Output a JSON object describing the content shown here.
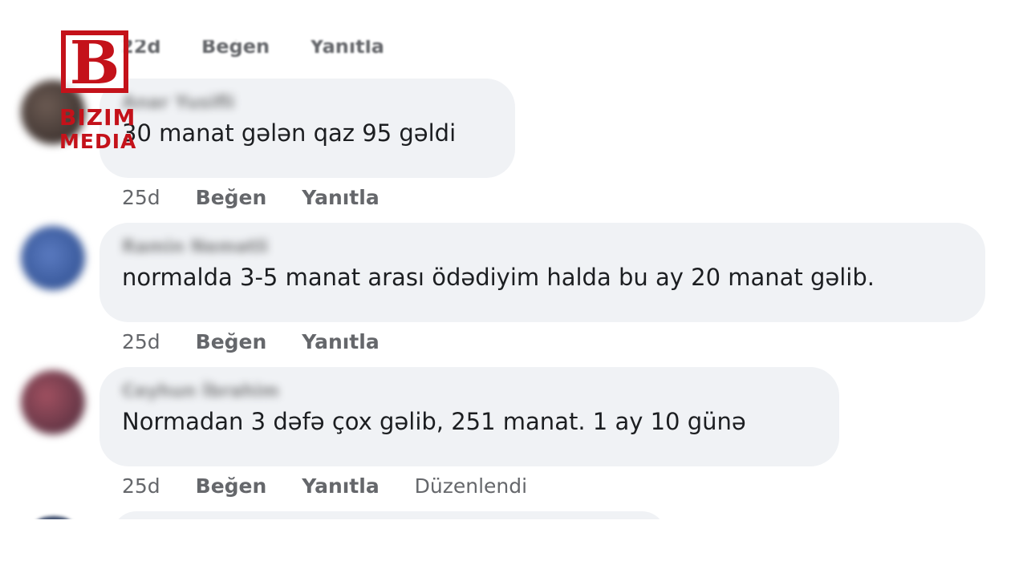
{
  "logo": {
    "letter": "B",
    "line1": "BIZIM",
    "line2": "MEDIA",
    "brand_color": "#c4121a"
  },
  "top_row": {
    "time": "22d",
    "like": "Beğen",
    "reply": "Yanıtla"
  },
  "comments": [
    {
      "author": "Anar Yusifli",
      "text": "30 manat gələn qaz 95 gəldi",
      "time": "25d",
      "like": "Beğen",
      "reply": "Yanıtla",
      "avatar_color": "#4a3a36"
    },
    {
      "author": "Ramin Nemətli",
      "text": "normalda 3-5 manat arası ödədiyim halda bu ay 20 manat gəlib.",
      "time": "25d",
      "like": "Beğen",
      "reply": "Yanıtla",
      "avatar_color": "#3b5a9a"
    },
    {
      "author": "Ceyhun İbrahim",
      "text": "Normadan 3 dəfə çox gəlib, 251 manat. 1 ay 10 günə",
      "time": "25d",
      "like": "Beğen",
      "reply": "Yanıtla",
      "edited": "Düzenlendi",
      "avatar_color": "#7a3a40"
    }
  ],
  "colors": {
    "bubble": "#f0f2f5",
    "meta_text": "#65676b",
    "body_text": "#1c1e21"
  }
}
